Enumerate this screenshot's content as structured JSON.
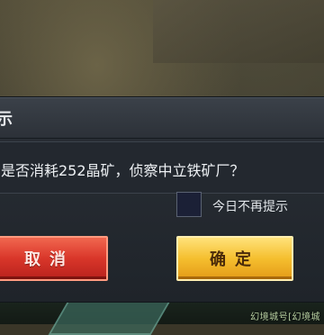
{
  "background": {
    "map_label": "幻境城号[幻境城"
  },
  "dialog": {
    "title": "示",
    "message": "是否消耗252晶矿，侦察中立铁矿厂？",
    "checkbox_label": "今日不再提示",
    "checkbox_checked": false,
    "cancel_label": "取消",
    "confirm_label": "确定"
  },
  "colors": {
    "cancel": "#d9362a",
    "confirm": "#f5bf2f",
    "dialog_bg": "#23282f"
  }
}
